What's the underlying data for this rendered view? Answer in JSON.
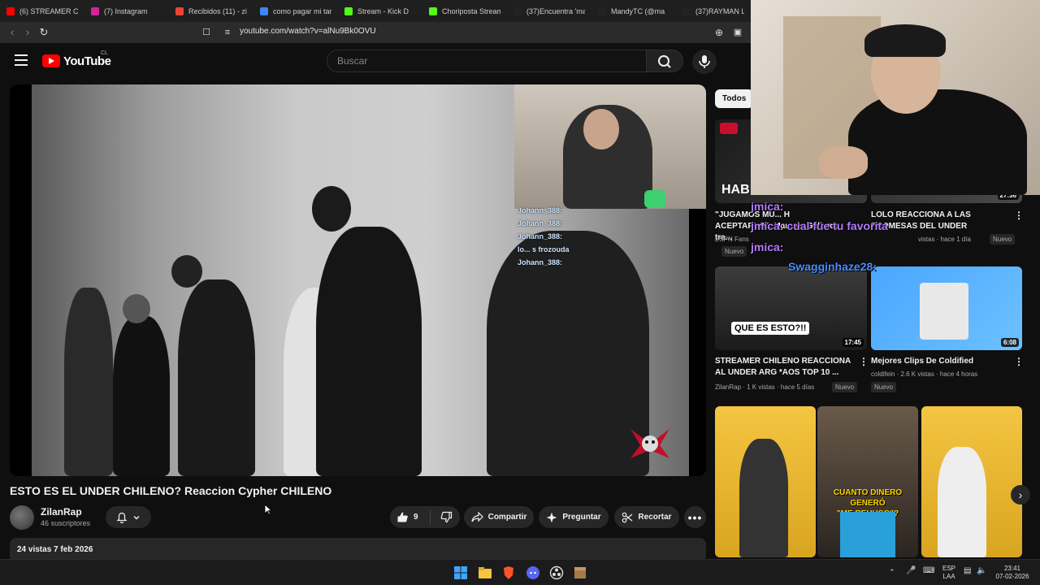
{
  "tabs": [
    {
      "label": "(6) STREAMER CHILE",
      "color": "#ff0000"
    },
    {
      "label": "(7) Instagram",
      "color": "#d6249f"
    },
    {
      "label": "Recibidos (11) - zila",
      "color": "#ea4335"
    },
    {
      "label": "como pagar mi tarj",
      "color": "#4285f4"
    },
    {
      "label": "Stream - Kick D",
      "color": "#53fc18"
    },
    {
      "label": "Choriposta Stream",
      "color": "#53fc18"
    },
    {
      "label": "(37)Encuentra 'mar",
      "color": "#222222"
    },
    {
      "label": "MandyTC (@ma",
      "color": "#222222"
    },
    {
      "label": "(37)RAYMAN LEGE",
      "color": "#222222"
    }
  ],
  "address": {
    "url": "youtube.com/watch?v=alNu9Bk0OVU"
  },
  "header": {
    "logo": "YouTube",
    "region": "CL",
    "search_placeholder": "Buscar"
  },
  "video": {
    "title": "ESTO ES EL UNDER CHILENO? Reaccion Cypher CHILENO",
    "channel": "ZilanRap",
    "subscribers": "46 suscriptores",
    "likes": "9",
    "share_label": "Compartir",
    "ask_label": "Preguntar",
    "clip_label": "Recortar",
    "views_date": "24 vistas  7 feb 2026",
    "overlay_chat": [
      "Johann_388:",
      "Johann_388:",
      "Johann_388:",
      "lo... s frozouda",
      "Johann_388:"
    ]
  },
  "sidebar": {
    "chip": "Todos",
    "items": [
      {
        "title_l1": "\"JUGAMOS MU... H",
        "title_l2": "ACEPTARLO\": Marcelo Gallardo tra...",
        "meta": "ESPN Fans",
        "badge": "Nuevo",
        "duration": ""
      },
      {
        "title_l1": "LOLO REACCIONA A LAS",
        "title_l2": "PROMESAS DEL UNDER",
        "meta": "vistas · hace 1 día",
        "badge": "Nuevo",
        "duration": "27:36"
      },
      {
        "title_l1": "STREAMER CHILENO REACCIONA",
        "title_l2": "AL UNDER ARG *AOS TOP 10 ...",
        "meta": "ZilanRap · 1 K vistas · hace 5 días",
        "badge": "Nuevo",
        "duration": "17:45",
        "thumb_text": "QUE ES ESTO?!!"
      },
      {
        "title_l1": "Mejores Clips De Coldified",
        "title_l2": "",
        "meta": "coldifein · 2.6 K vistas · hace 4 horas",
        "badge": "Nuevo",
        "duration": "6:08"
      }
    ],
    "shorts_text": [
      "CUANTO DINERO GENERÓ",
      "\"ME REHUSO\"?"
    ]
  },
  "overlay_chat": [
    {
      "text": "jmica:",
      "color": "#b57bff"
    },
    {
      "text": "jmica: cual fue tu favorita",
      "color": "#b57bff"
    },
    {
      "text": "jmica:",
      "color": "#b57bff"
    },
    {
      "text": "Swagginhaze28:",
      "color": "#4d8cff"
    }
  ],
  "taskbar": {
    "lang1": "ESP",
    "lang2": "LAA",
    "time": "23:41",
    "date": "07-02-2026"
  }
}
